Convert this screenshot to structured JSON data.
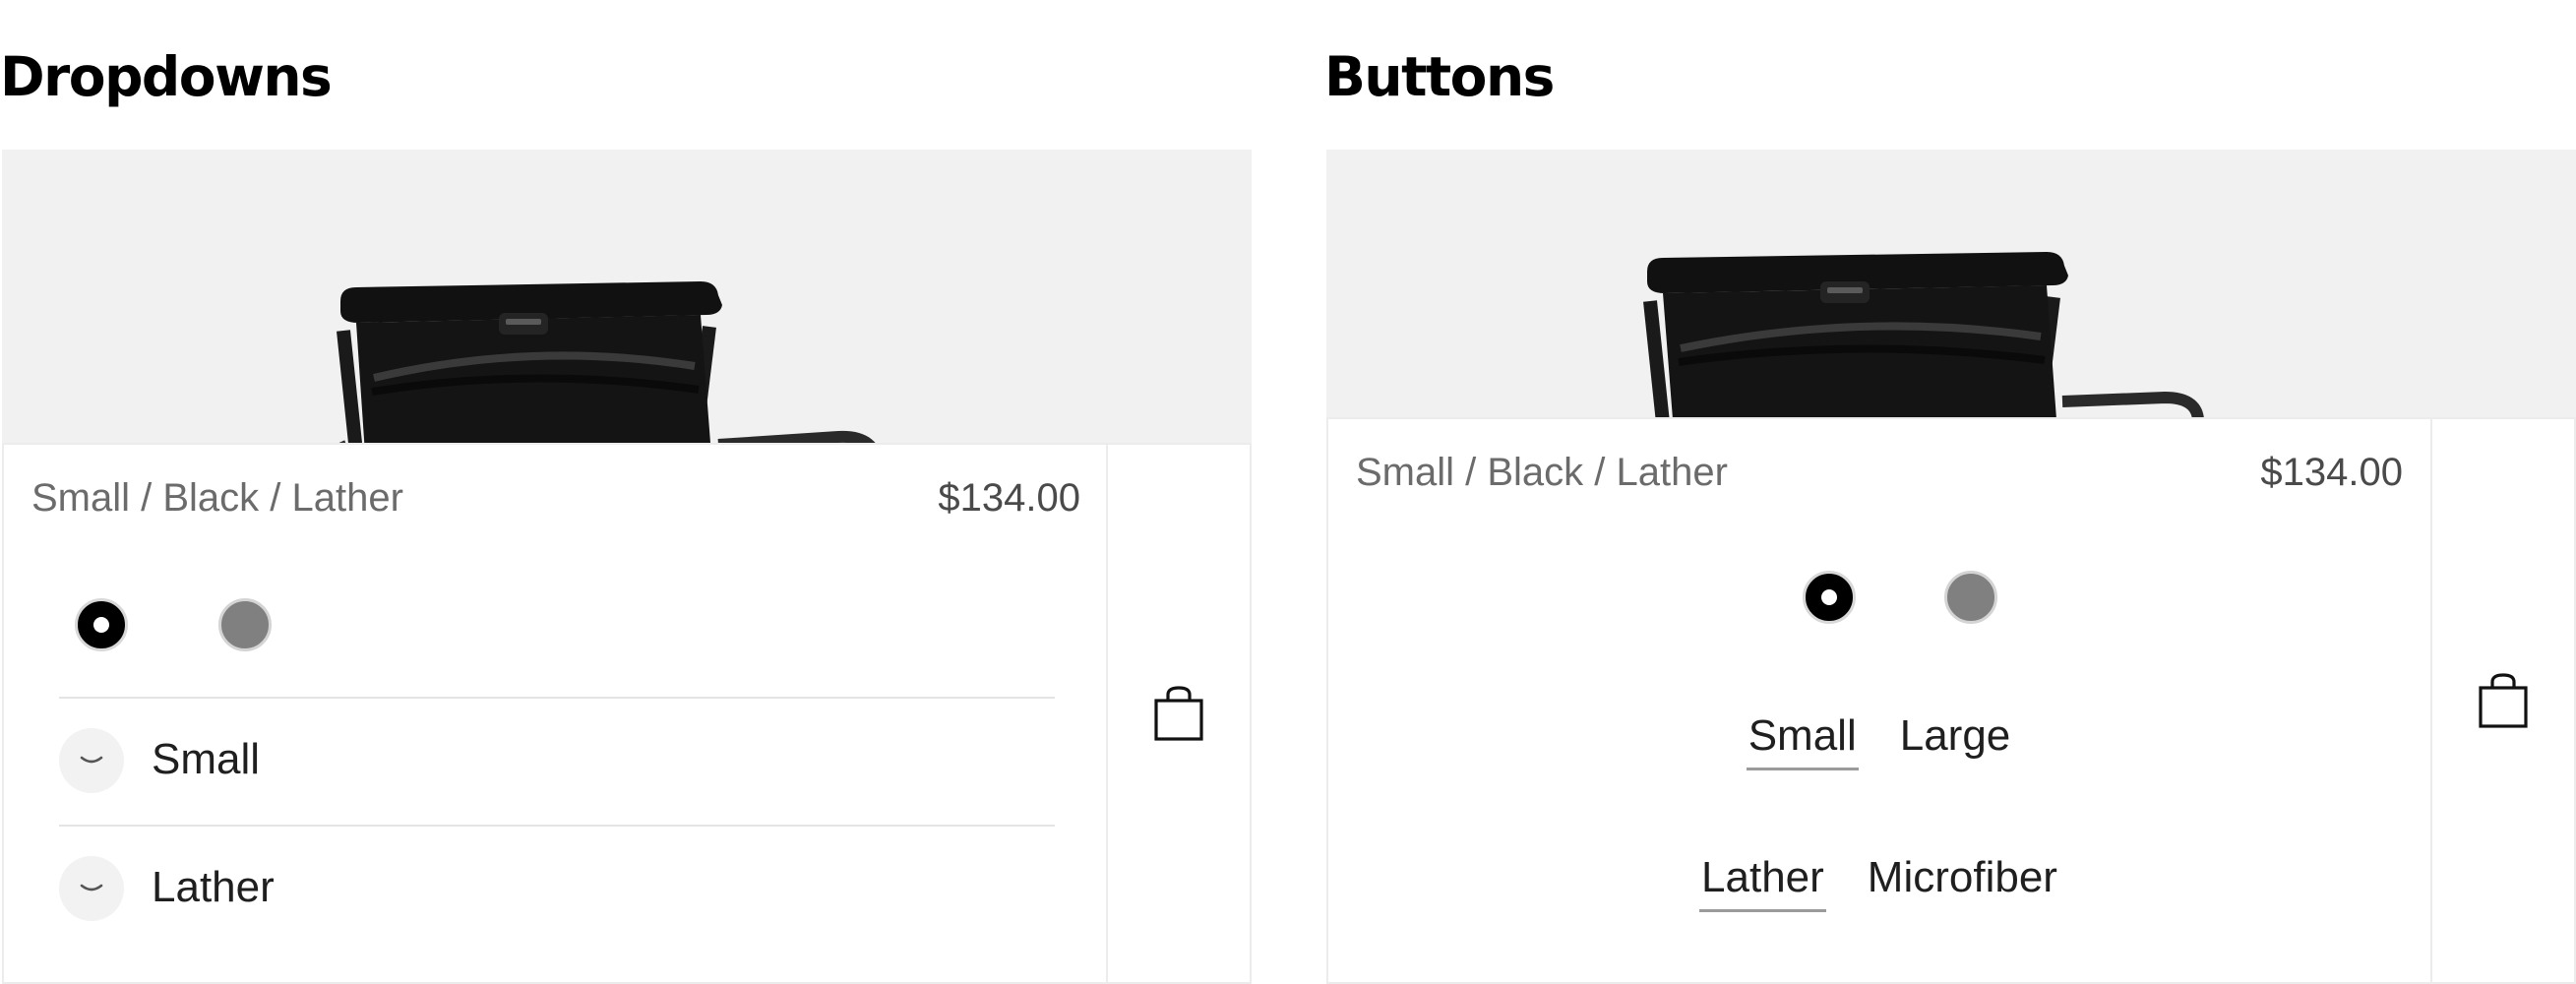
{
  "left": {
    "title": "Dropdowns",
    "variant": "Small / Black / Lather",
    "price": "$134.00",
    "swatches": [
      {
        "name": "Black",
        "color": "#000000",
        "selected": true
      },
      {
        "name": "Gray",
        "color": "#808080",
        "selected": false
      }
    ],
    "dropdowns": [
      {
        "value": "Small"
      },
      {
        "value": "Lather"
      }
    ]
  },
  "right": {
    "title": "Buttons",
    "variant": "Small / Black / Lather",
    "price": "$134.00",
    "swatches": [
      {
        "name": "Black",
        "color": "#000000",
        "selected": true
      },
      {
        "name": "Gray",
        "color": "#808080",
        "selected": false
      }
    ],
    "sizes": [
      {
        "label": "Small",
        "selected": true
      },
      {
        "label": "Large",
        "selected": false
      }
    ],
    "materials": [
      {
        "label": "Lather",
        "selected": true
      },
      {
        "label": "Microfiber",
        "selected": false
      }
    ]
  },
  "icons": {
    "cart": "shopping-bag-icon",
    "chevron": "chevron-down-icon"
  },
  "colors": {
    "image_background": "#f1f1f1",
    "border": "#ececec",
    "selected_underline": "#9a9a9a"
  }
}
